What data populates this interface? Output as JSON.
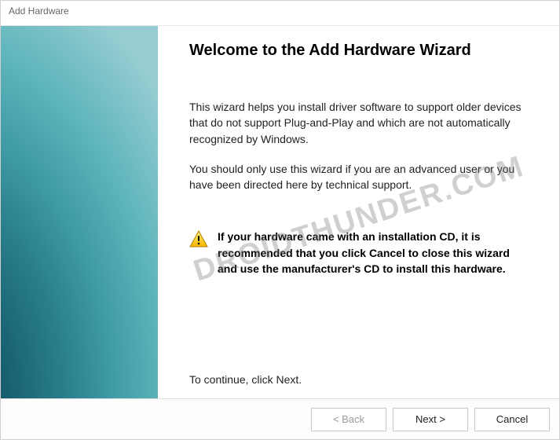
{
  "window": {
    "title": "Add Hardware"
  },
  "content": {
    "heading": "Welcome to the Add Hardware Wizard",
    "paragraph1": "This wizard helps you install driver software to support older devices that do not support Plug-and-Play and which are not automatically recognized by Windows.",
    "paragraph2": "You should only use this wizard if you are an advanced user or you have been directed here by technical support.",
    "warning": "If your hardware came with an installation CD, it is recommended that you click Cancel to close this wizard and use the manufacturer's CD to install this hardware.",
    "continue": "To continue, click Next."
  },
  "buttons": {
    "back": "< Back",
    "next": "Next >",
    "cancel": "Cancel"
  },
  "watermark": "DROIDTHUNDER.COM"
}
